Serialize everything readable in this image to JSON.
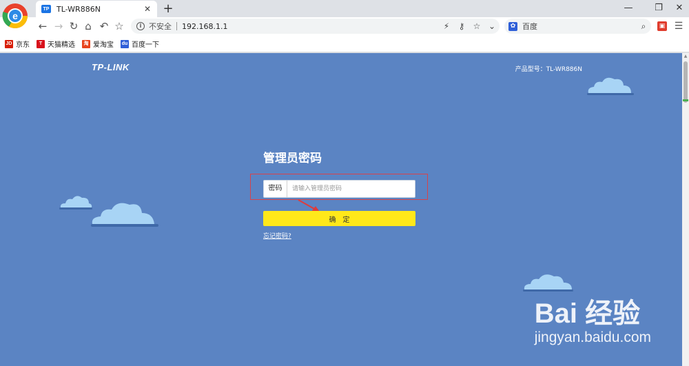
{
  "browser": {
    "tab_title": "TL-WR886N",
    "tab_favicon": "TP",
    "new_tab": "+",
    "url": "192.168.1.1",
    "security_label": "不安全",
    "search_placeholder": "百度",
    "window_controls": [
      "minimize-icon",
      "restore-icon",
      "close-icon"
    ]
  },
  "bookmarks": [
    {
      "label": "京东",
      "icon": "JD",
      "color": "#d81e06"
    },
    {
      "label": "天猫精选",
      "icon": "T",
      "color": "#d8111b"
    },
    {
      "label": "爱淘宝",
      "icon": "淘",
      "color": "#e8431c"
    },
    {
      "label": "百度一下",
      "icon": "du",
      "color": "#2f5fd8"
    }
  ],
  "page": {
    "logo": "TP-LINK",
    "model_label": "产品型号：TL-WR886N",
    "title": "管理员密码",
    "password_label": "密码",
    "password_placeholder": "请输入管理员密码",
    "confirm_label": "确定",
    "forgot_link": "忘记密码?",
    "background_color": "#5b84c3",
    "button_color": "#ffe81a"
  },
  "watermark": {
    "main": "Bai 经验",
    "sub": "jingyan.baidu.com"
  }
}
